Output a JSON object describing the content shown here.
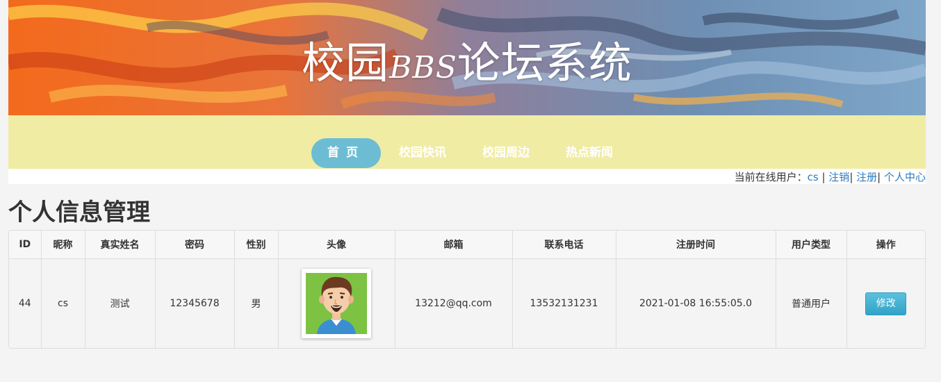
{
  "header": {
    "title_prefix": "校园",
    "title_latin": "BBS",
    "title_suffix": "论坛系统"
  },
  "nav": {
    "items": [
      {
        "label": "首页"
      },
      {
        "label": "校园快讯"
      },
      {
        "label": "校园周边"
      },
      {
        "label": "热点新闻"
      }
    ],
    "active_color": "#6cbdd3",
    "bar_color": "#f0eca4"
  },
  "userbar": {
    "prefix": "当前在线用户：",
    "username": "cs",
    "sep1": " | ",
    "logout": "注销",
    "sep2": "| ",
    "register": "注册",
    "sep3": "| ",
    "center": "个人中心",
    "link_color": "#2b7bc0"
  },
  "page": {
    "heading": "个人信息管理"
  },
  "table": {
    "headers": [
      "ID",
      "昵称",
      "真实姓名",
      "密码",
      "性别",
      "头像",
      "邮箱",
      "联系电话",
      "注册时间",
      "用户类型",
      "操作"
    ],
    "row": {
      "id": "44",
      "nickname": "cs",
      "realname": "测试",
      "password": "12345678",
      "gender": "男",
      "email": "13212@qq.com",
      "phone": "13532131231",
      "registered": "2021-01-08 16:55:05.0",
      "usertype": "普通用户",
      "action": "修改"
    }
  }
}
